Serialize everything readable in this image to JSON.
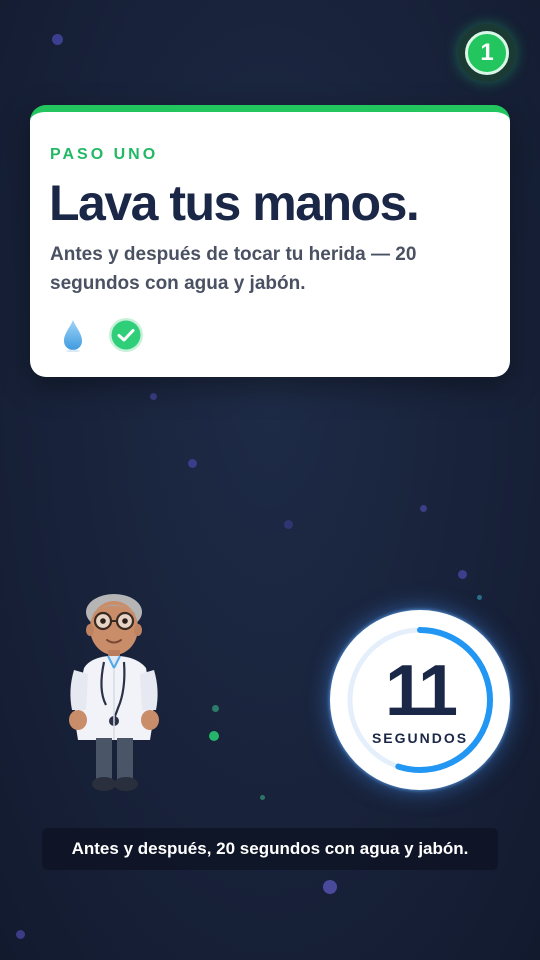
{
  "step": {
    "number": "1",
    "eyebrow": "PASO UNO",
    "title": "Lava tus manos.",
    "description": "Antes y después de tocar tu herida — 20 segundos con agua y jabón.",
    "icons": [
      "water-drop-icon",
      "check-circle-icon"
    ]
  },
  "timer": {
    "seconds": "11",
    "unit": "SEGUNDOS",
    "progress": 0.55,
    "accent": "#2196f3"
  },
  "caption": "Antes y después, 20 segundos con agua y jabón.",
  "colors": {
    "accent_green": "#22c55e",
    "title_navy": "#1b2747",
    "background": "#18223a"
  }
}
